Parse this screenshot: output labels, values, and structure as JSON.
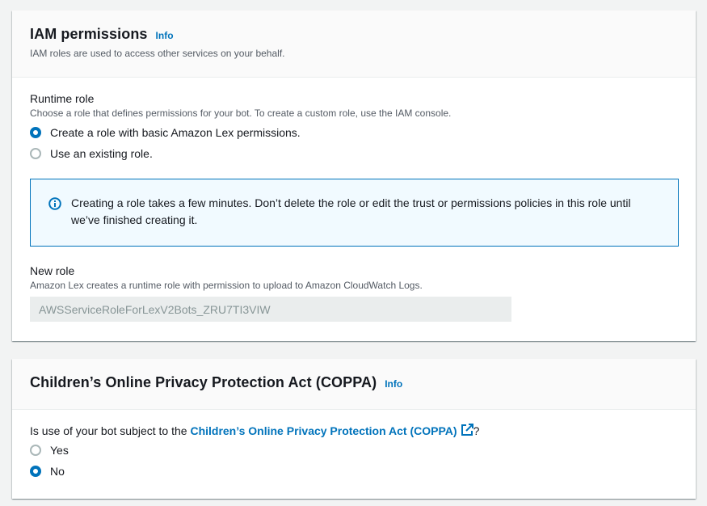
{
  "iam": {
    "title": "IAM permissions",
    "info_label": "Info",
    "description": "IAM roles are used to access other services on your behalf.",
    "runtime_role": {
      "label": "Runtime role",
      "description": "Choose a role that defines permissions for your bot. To create a custom role, use the IAM console.",
      "options": [
        {
          "label": "Create a role with basic Amazon Lex permissions.",
          "checked": true
        },
        {
          "label": "Use an existing role.",
          "checked": false
        }
      ]
    },
    "alert": {
      "text": "Creating a role takes a few minutes. Don’t delete the role or edit the trust or permissions policies in this role until we’ve finished creating it."
    },
    "new_role": {
      "label": "New role",
      "description": "Amazon Lex creates a runtime role with permission to upload to Amazon CloudWatch Logs.",
      "value": "AWSServiceRoleForLexV2Bots_ZRU7TI3VIW"
    }
  },
  "coppa": {
    "title": "Children’s Online Privacy Protection Act (COPPA)",
    "info_label": "Info",
    "question_prefix": "Is use of your bot subject to the ",
    "question_link": "Children’s Online Privacy Protection Act (COPPA)",
    "question_suffix": "?",
    "options": [
      {
        "label": "Yes",
        "checked": false
      },
      {
        "label": "No",
        "checked": true
      }
    ]
  },
  "colors": {
    "accent": "#0073bb",
    "alert_bg": "#f1faff",
    "page_bg": "#f2f3f3"
  }
}
